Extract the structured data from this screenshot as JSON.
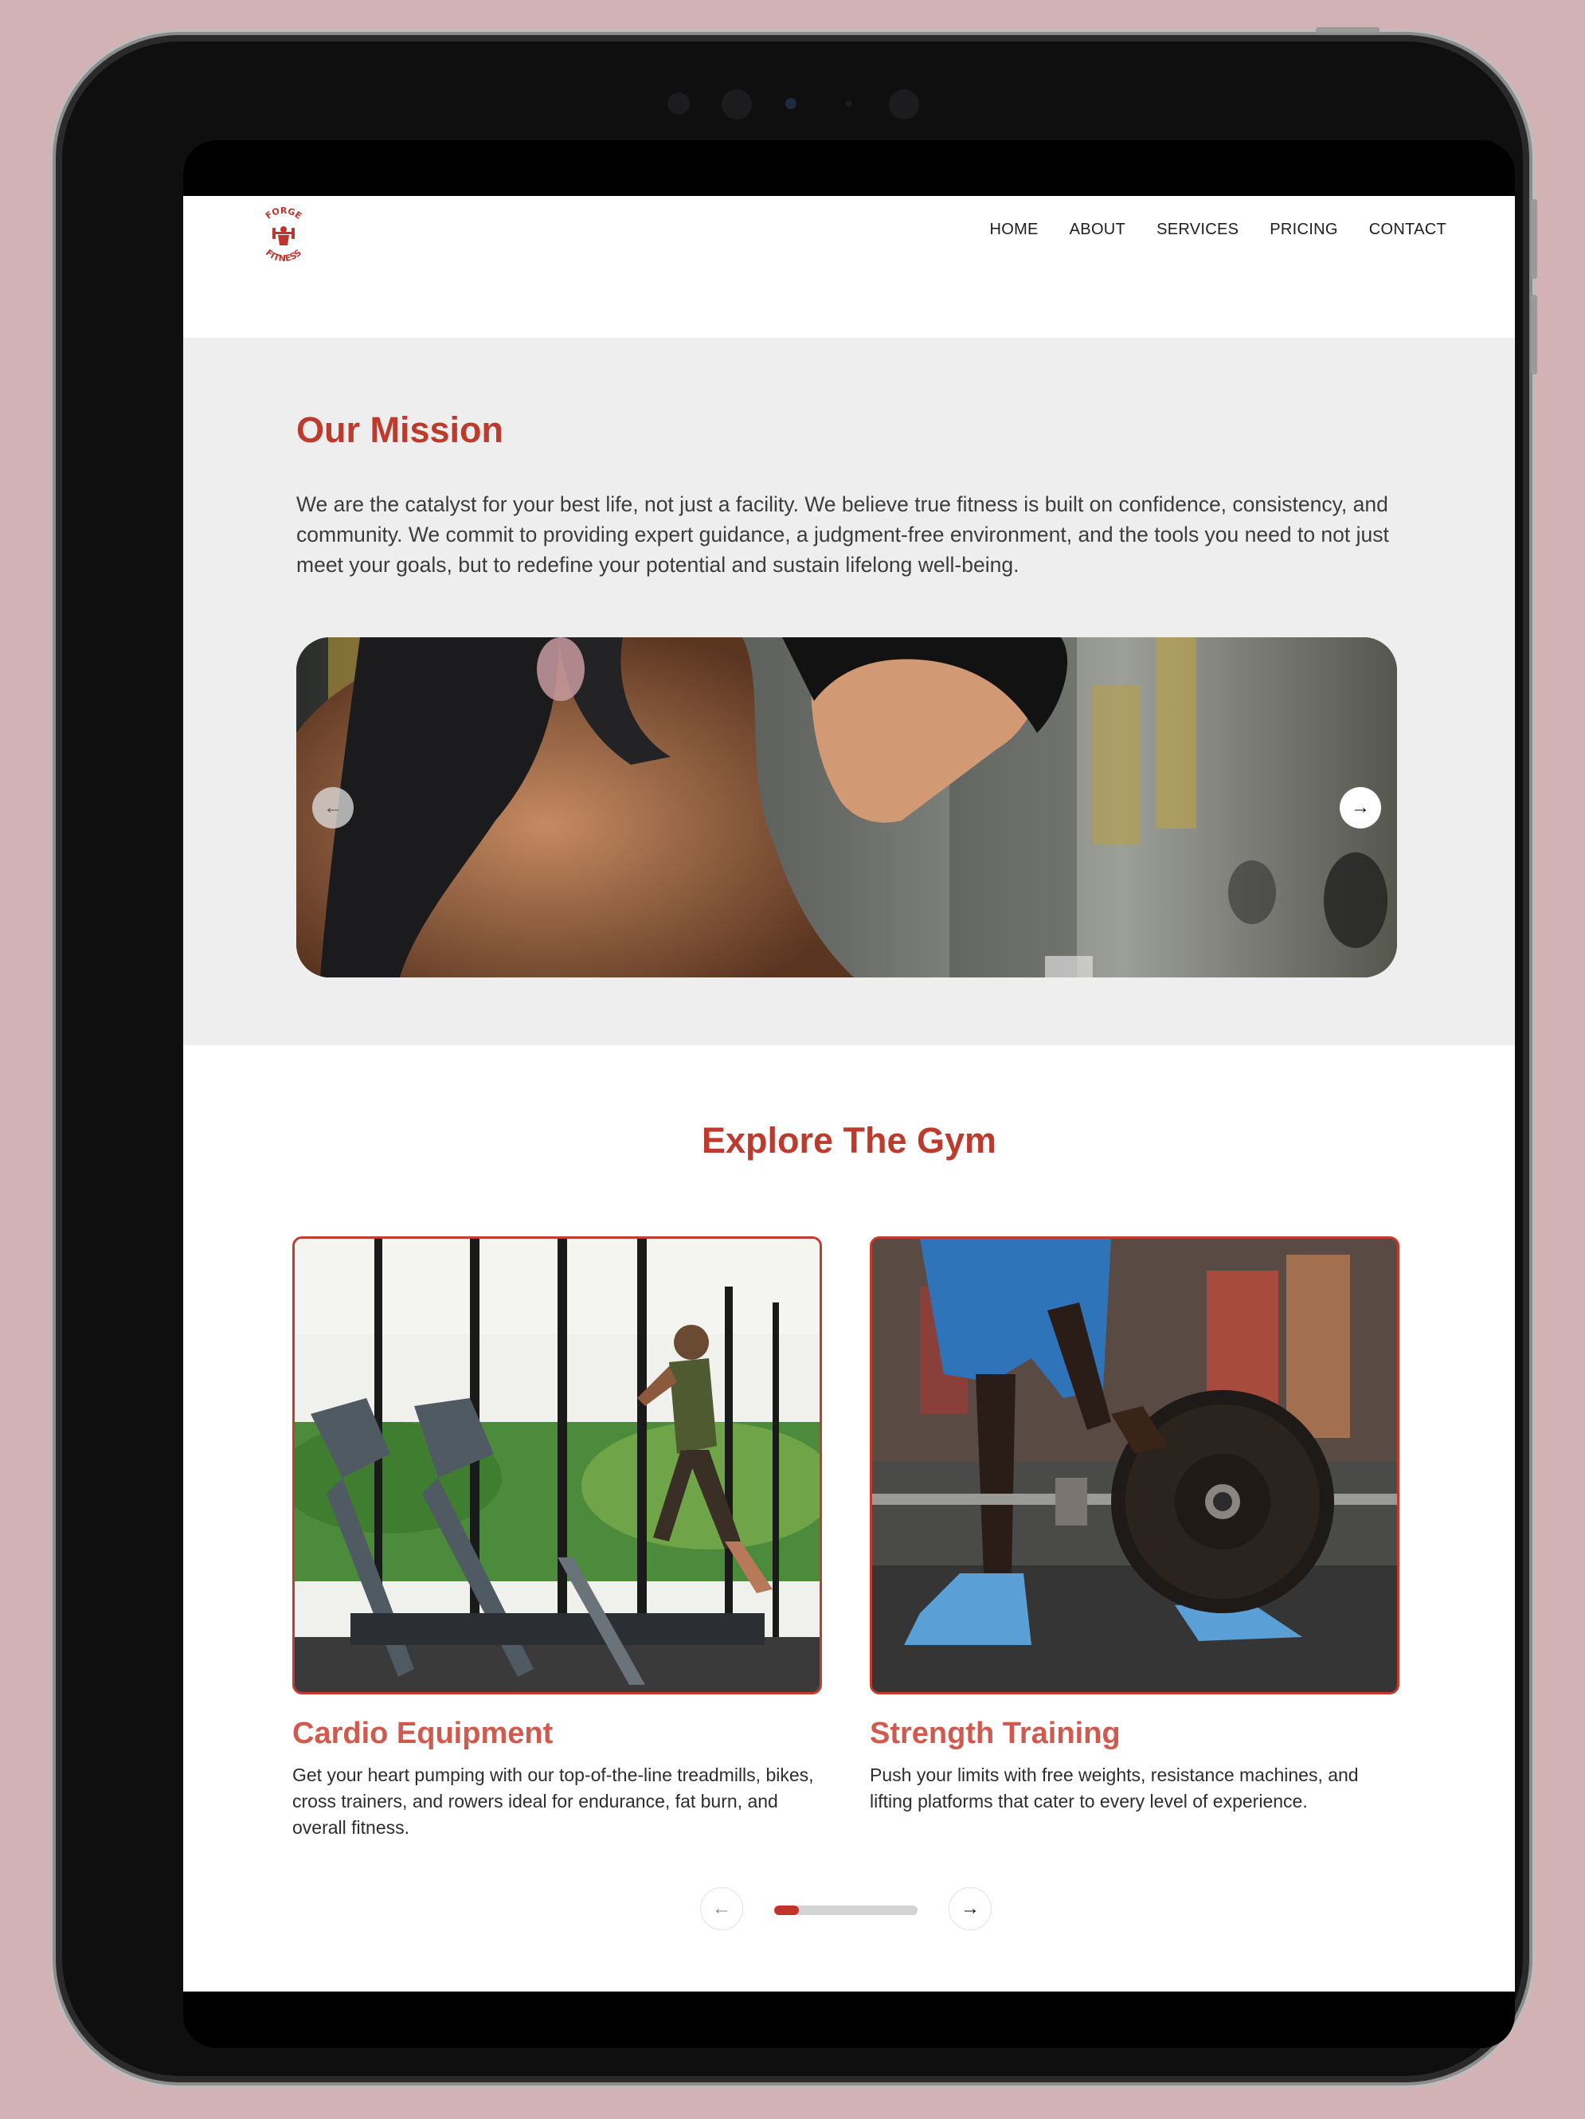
{
  "brand": {
    "logo_top": "FORGE",
    "logo_bottom": "FITNESS",
    "accent_color": "#bd3b2d"
  },
  "nav": {
    "items": [
      "HOME",
      "ABOUT",
      "SERVICES",
      "PRICING",
      "CONTACT"
    ]
  },
  "mission": {
    "title": "Our Mission",
    "text": "We are the catalyst for your best life, not just a facility. We believe true fitness is built on confidence, consistency, and community. We commit to providing expert guidance, a judgment-free environment, and the tools you need to not just meet your goals, but to redefine your potential and sustain lifelong well-being.",
    "slider": {
      "prev_icon": "arrow-left-icon",
      "next_icon": "arrow-right-icon",
      "prev_glyph": "←",
      "next_glyph": "→"
    }
  },
  "explore": {
    "title": "Explore The Gym",
    "cards": [
      {
        "title": "Cardio Equipment",
        "text": "Get your heart pumping with our top-of-the-line treadmills, bikes, cross trainers, and rowers ideal for endurance, fat burn, and overall fitness."
      },
      {
        "title": "Strength Training",
        "text": "Push your limits with free weights, resistance machines, and lifting platforms that cater to every level of experience."
      }
    ],
    "pager": {
      "prev_glyph": "←",
      "next_glyph": "→",
      "progress": 0.17
    }
  }
}
